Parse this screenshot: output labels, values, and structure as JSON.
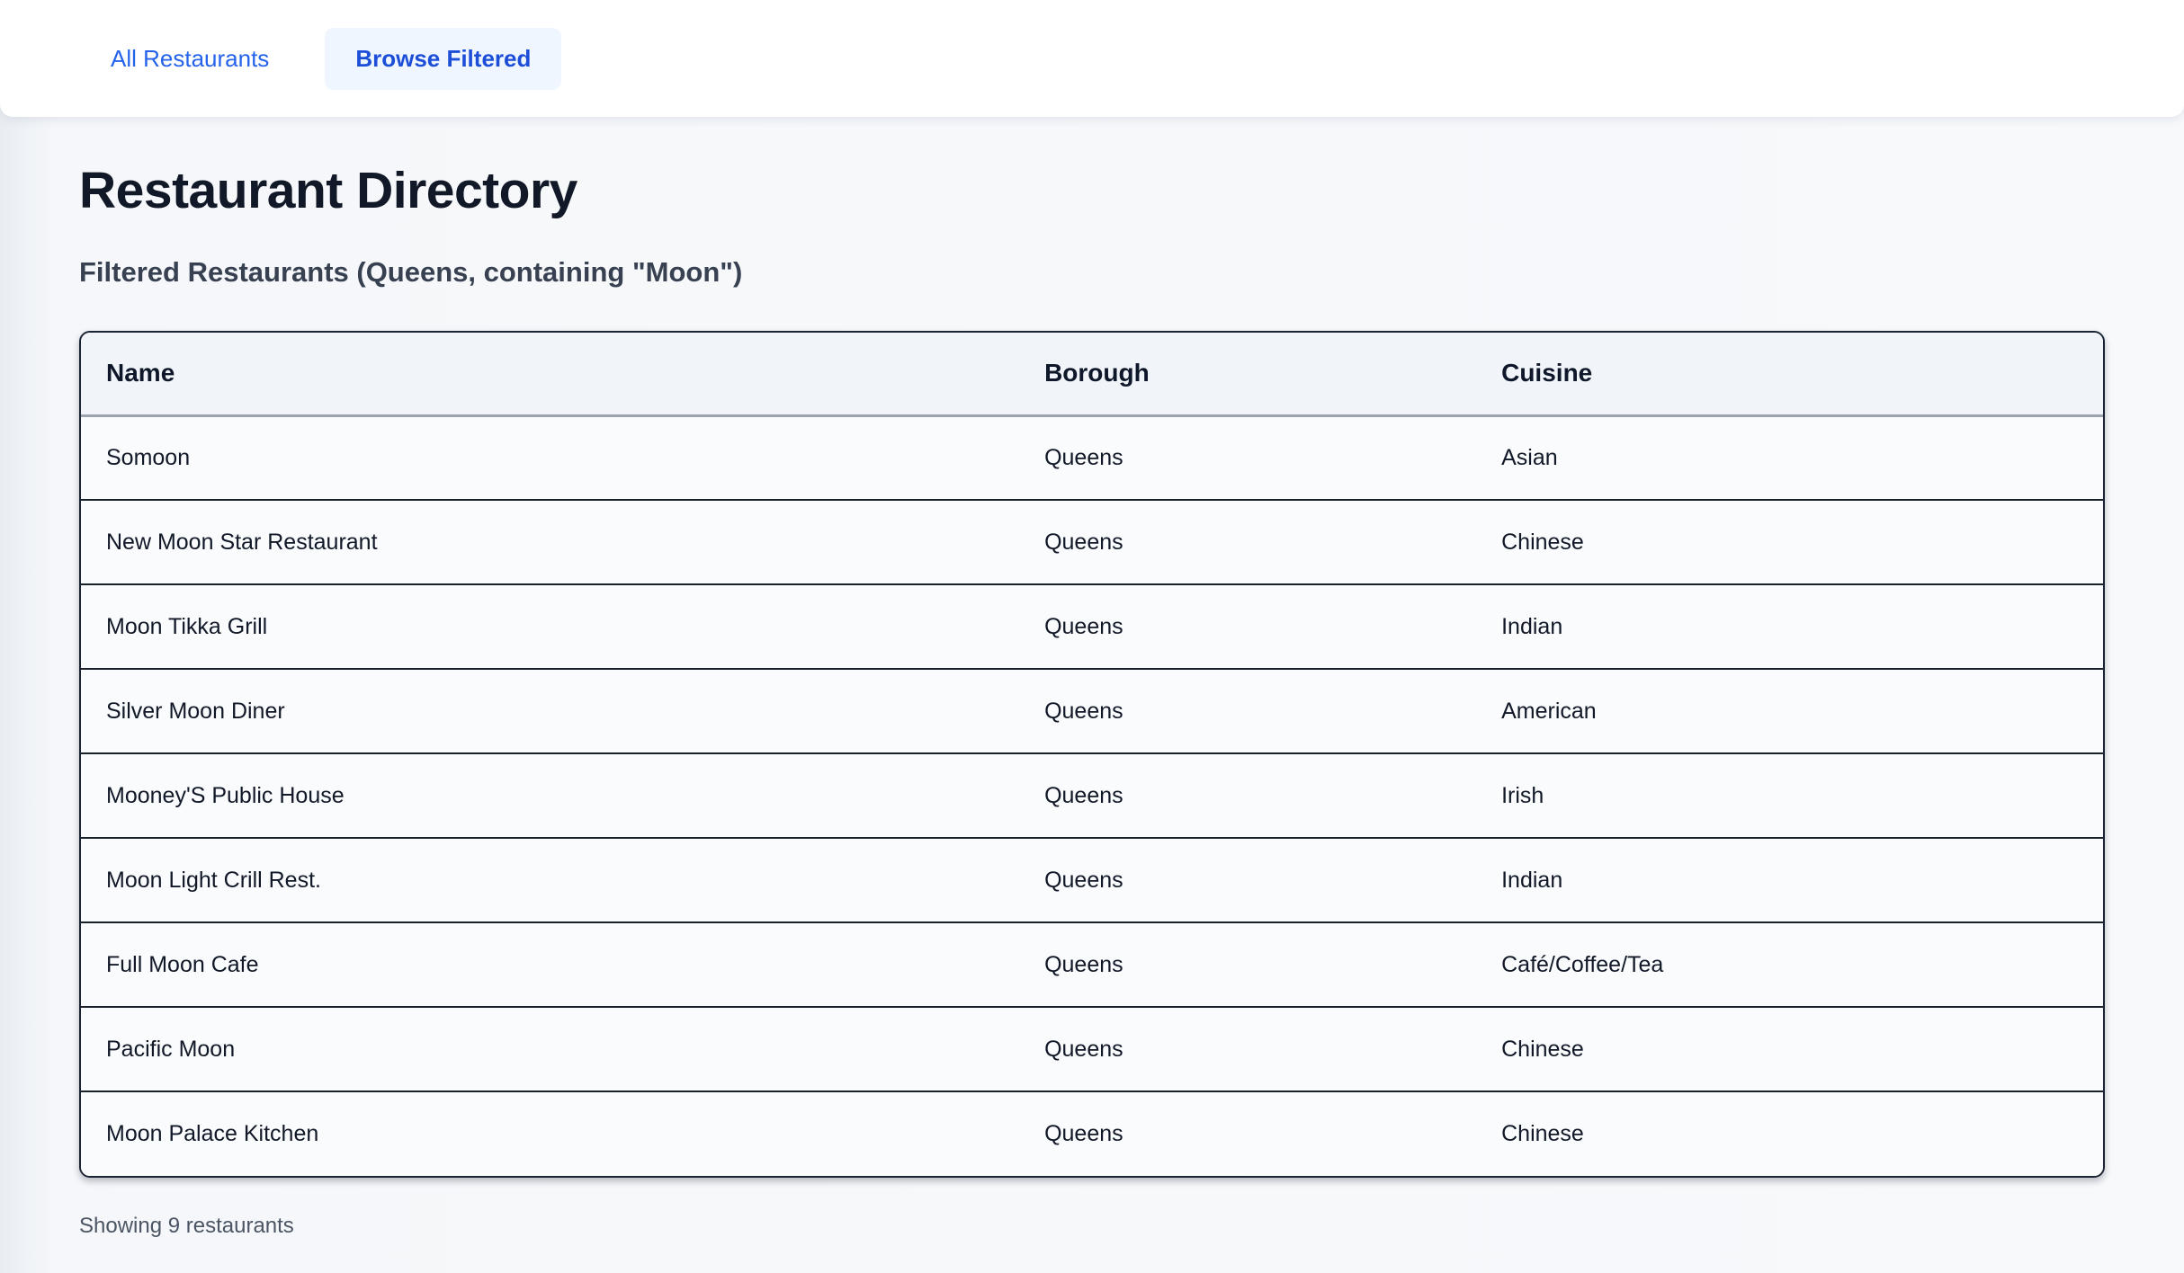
{
  "tabs": {
    "all_restaurants": "All Restaurants",
    "browse_filtered": "Browse Filtered"
  },
  "page": {
    "title": "Restaurant Directory",
    "subtitle": "Filtered Restaurants (Queens, containing \"Moon\")",
    "footer": "Showing 9 restaurants"
  },
  "table": {
    "headers": {
      "name": "Name",
      "borough": "Borough",
      "cuisine": "Cuisine"
    },
    "rows": [
      {
        "name": "Somoon",
        "borough": "Queens",
        "cuisine": "Asian"
      },
      {
        "name": "New Moon Star Restaurant",
        "borough": "Queens",
        "cuisine": "Chinese"
      },
      {
        "name": "Moon Tikka Grill",
        "borough": "Queens",
        "cuisine": "Indian"
      },
      {
        "name": "Silver Moon Diner",
        "borough": "Queens",
        "cuisine": "American"
      },
      {
        "name": "Mooney'S Public House",
        "borough": "Queens",
        "cuisine": "Irish"
      },
      {
        "name": "Moon Light Crill Rest.",
        "borough": "Queens",
        "cuisine": "Indian"
      },
      {
        "name": "Full Moon Cafe",
        "borough": "Queens",
        "cuisine": "Café/Coffee/Tea"
      },
      {
        "name": "Pacific Moon",
        "borough": "Queens",
        "cuisine": "Chinese"
      },
      {
        "name": "Moon Palace Kitchen",
        "borough": "Queens",
        "cuisine": "Chinese"
      }
    ]
  },
  "colors": {
    "accent_blue": "#2563eb",
    "active_tab_text": "#1d4ed8",
    "active_tab_bg": "#eff6ff",
    "header_row_bg": "#f1f5f9",
    "row_border": "#171f2b",
    "header_border": "#9ca3af",
    "page_bg": "#f7f9fb",
    "text_primary": "#111827",
    "text_secondary": "#374151",
    "text_muted": "#4b5563"
  }
}
